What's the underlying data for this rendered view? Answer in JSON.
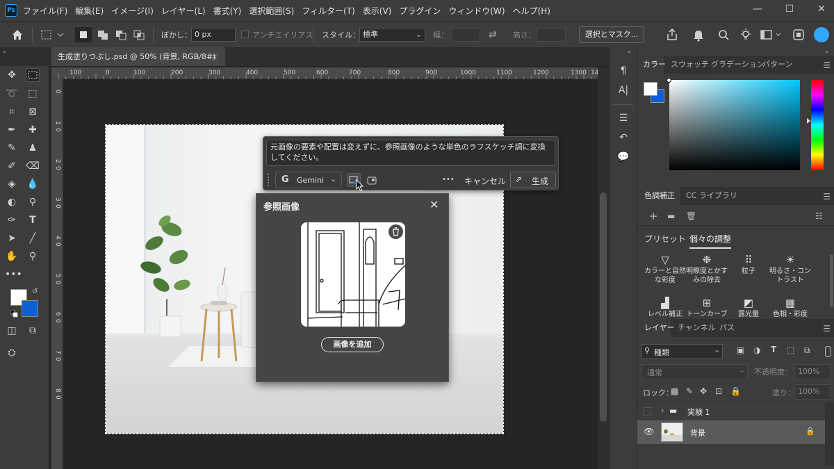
{
  "menu": {
    "items": [
      "ファイル(F)",
      "編集(E)",
      "イメージ(I)",
      "レイヤー(L)",
      "書式(Y)",
      "選択範囲(S)",
      "フィルター(T)",
      "表示(V)",
      "プラグイン",
      "ウィンドウ(W)",
      "ヘルプ(H)"
    ],
    "logo": "Ps"
  },
  "options_bar": {
    "feather_label": "ぼかし：",
    "feather_value": "0 px",
    "antialias_label": "アンチエイリアス",
    "style_label": "スタイル：",
    "style_value": "標準",
    "width_label": "幅：",
    "height_label": "高さ：",
    "select_mask_button": "選択とマスク..."
  },
  "document_tab": {
    "title": "生成塗りつぶし.psd @ 50% (背景, RGB/8#)"
  },
  "ruler": {
    "top_ticks": [
      "100",
      "0",
      "100",
      "200",
      "300",
      "400",
      "500",
      "600",
      "700",
      "800",
      "900",
      "1000",
      "1100",
      "1200",
      "1300",
      "14"
    ],
    "left_ticks": [
      "0",
      "1",
      "0",
      "2",
      "0",
      "3",
      "0",
      "4",
      "0",
      "5",
      "0",
      "6",
      "0",
      "7",
      "0",
      "8",
      "0"
    ]
  },
  "gen_fill": {
    "prompt": "元画像の要素や配置は変えずに、参照画像のような単色のラフスケッチ調に変換してください。",
    "model": "Gemini",
    "more": "•••",
    "cancel": "キャンセル",
    "generate": "生成"
  },
  "reference_panel": {
    "title": "参照画像",
    "add_image": "画像を追加"
  },
  "color_panel": {
    "tabs": [
      "カラー",
      "スウォッチ",
      "グラデーション",
      "パターン"
    ]
  },
  "adjust_panel": {
    "tabs": [
      "色調補正",
      "CC ライブラリ"
    ],
    "subtabs": [
      "プリセット",
      "個々の調整"
    ],
    "items": [
      {
        "label": "カラーと自然な彩度",
        "icon": "vibrance-icon"
      },
      {
        "label": "明瞭度とかすみの除去",
        "icon": "clarity-icon"
      },
      {
        "label": "粒子",
        "icon": "grain-icon"
      },
      {
        "label": "明るさ・コントラスト",
        "icon": "brightness-icon"
      },
      {
        "label": "レベル補正",
        "icon": "levels-icon"
      },
      {
        "label": "トーンカーブ",
        "icon": "curves-icon"
      },
      {
        "label": "露光量",
        "icon": "exposure-icon"
      },
      {
        "label": "色相・彩度",
        "icon": "hue-icon"
      }
    ]
  },
  "layers_panel": {
    "tabs": [
      "レイヤー",
      "チャンネル",
      "パス"
    ],
    "filter_kind": "種類",
    "blend_mode": "通常",
    "opacity_label": "不透明度：",
    "opacity_value": "100%",
    "lock_label": "ロック：",
    "fill_label": "塗り：",
    "fill_value": "100%",
    "layers": [
      {
        "name": "実験 1",
        "type": "group",
        "visible": false
      },
      {
        "name": "背景",
        "type": "image",
        "visible": true,
        "locked": true
      }
    ]
  },
  "colors": {
    "accent": "#1473e6",
    "foreground": "#ffffff",
    "background": "#0d5fd6"
  }
}
